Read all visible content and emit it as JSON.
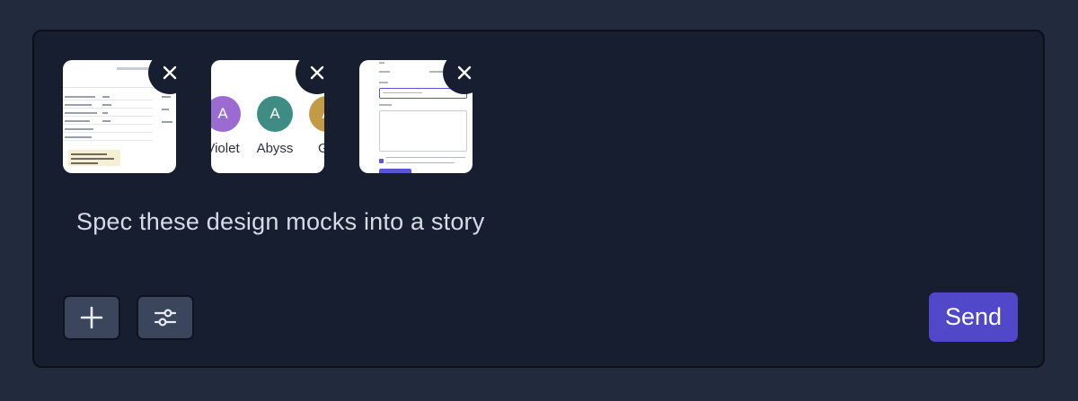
{
  "composer": {
    "message_text": "Spec these design mocks into a story",
    "attachments": [
      {
        "label": "table-mock"
      },
      {
        "label": "avatar-mock",
        "avatars": [
          {
            "initial": "A",
            "name": "Violet",
            "color": "#9b6bd1"
          },
          {
            "initial": "A",
            "name": "Abyss",
            "color": "#3f8c85"
          },
          {
            "initial": "A",
            "name": "Go",
            "color": "#c39a45"
          }
        ]
      },
      {
        "label": "form-mock"
      }
    ],
    "remove_icon": "close-icon",
    "add_icon": "plus-icon",
    "settings_icon": "sliders-icon",
    "send_label": "Send"
  },
  "colors": {
    "page_bg": "#222a3d",
    "composer_bg": "#171e30",
    "accent": "#5048c8"
  }
}
